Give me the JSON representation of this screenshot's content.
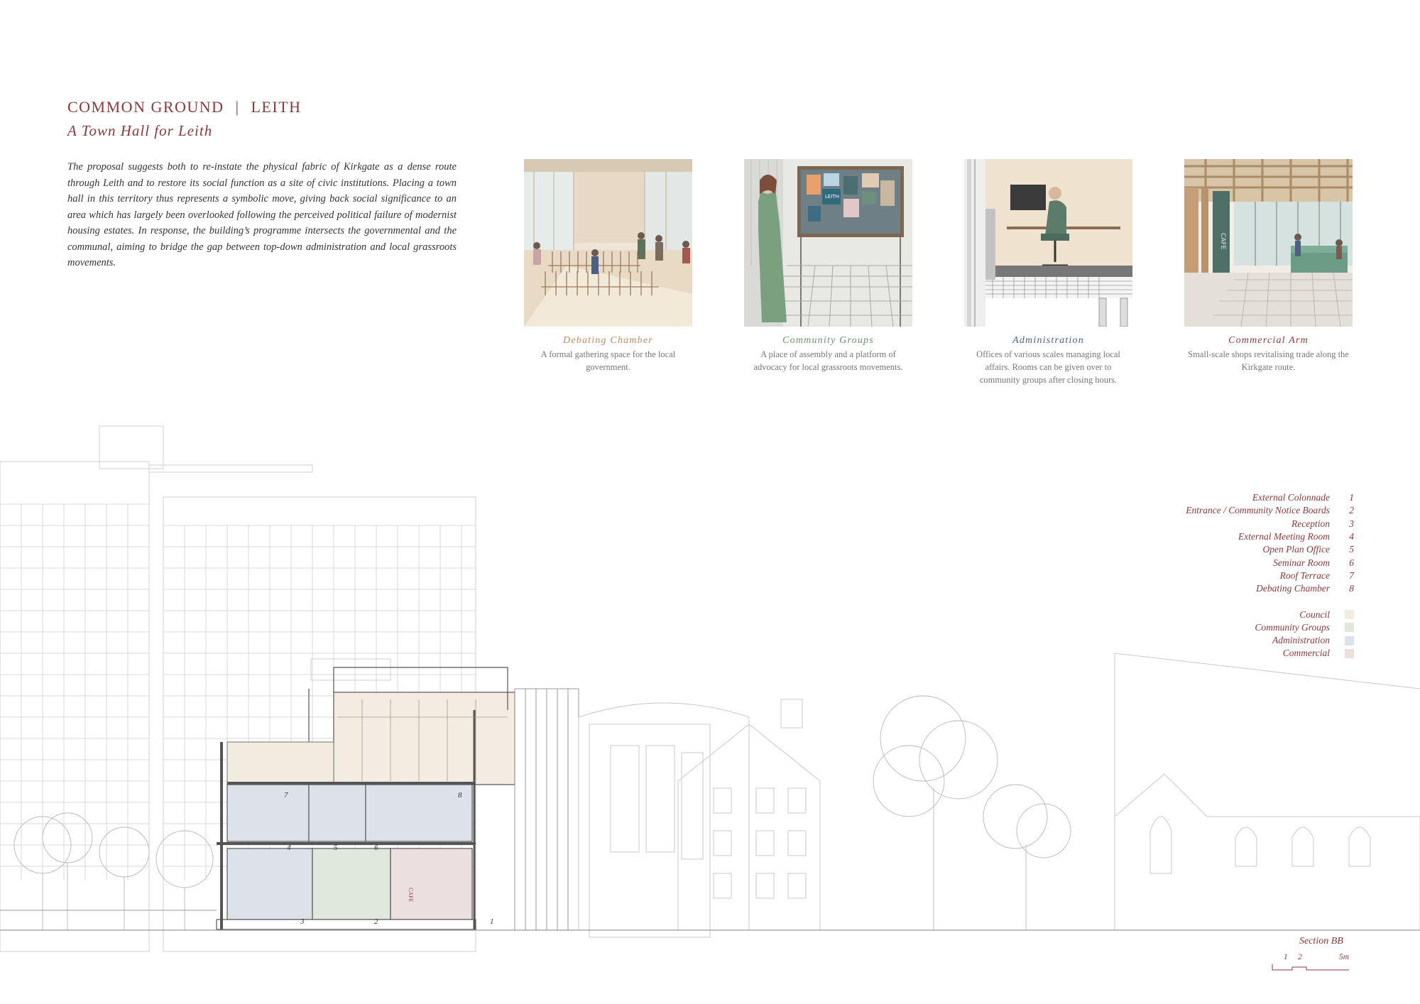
{
  "header": {
    "title_left": "COMMON GROUND",
    "title_sep": "|",
    "title_right": "LEITH",
    "subtitle": "A Town Hall for Leith"
  },
  "intro": "The proposal suggests both to re-instate the physical fabric of Kirkgate as a dense route through Leith and to restore its social function as a site of civic institutions. Placing a town hall in this territory thus represents a symbolic move, giving back social significance to an area which has largely been overlooked following the perceived political failure of modernist housing estates. In response, the building’s programme intersects the governmental and the communal, aiming to bridge the gap between top-down administration and local grassroots movements.",
  "vignettes": [
    {
      "title": "Debating Chamber",
      "desc": "A formal gathering space for the local government.",
      "color": "#c08a63"
    },
    {
      "title": "Community Groups",
      "desc": "A place of assembly and a platform of advocacy for local grassroots movements.",
      "color": "#6f8f72"
    },
    {
      "title": "Administration",
      "desc": "Offices of various scales managing local affairs. Rooms can be given over to community groups after closing hours.",
      "color": "#4e5f86"
    },
    {
      "title": "Commercial Arm",
      "desc": "Small-scale shops revitalising trade along the Kirkgate route.",
      "color": "#8a3a3c"
    }
  ],
  "vignette_images": {
    "debating": "",
    "notice_board": "LEITH",
    "cafe_sign": "CAFE"
  },
  "legend": {
    "rooms": [
      {
        "label": "External Colonnade",
        "num": "1"
      },
      {
        "label": "Entrance / Community Notice Boards",
        "num": "2"
      },
      {
        "label": "Reception",
        "num": "3"
      },
      {
        "label": "External Meeting Room",
        "num": "4"
      },
      {
        "label": "Open Plan Office",
        "num": "5"
      },
      {
        "label": "Seminar Room",
        "num": "6"
      },
      {
        "label": "Roof Terrace",
        "num": "7"
      },
      {
        "label": "Debating Chamber",
        "num": "8"
      }
    ],
    "zones": [
      {
        "label": "Council",
        "color": "#f1ebe0"
      },
      {
        "label": "Community Groups",
        "color": "#dfe8da"
      },
      {
        "label": "Administration",
        "color": "#dde2ea"
      },
      {
        "label": "Commercial",
        "color": "#ecdfe0"
      }
    ]
  },
  "section": {
    "label": "Section BB",
    "scale": {
      "t1": "1",
      "t2": "2",
      "t3": "5m"
    },
    "room_numbers": [
      "7",
      "8",
      "4",
      "5",
      "6",
      "3",
      "2",
      "1"
    ],
    "cafe_text": "CAFE"
  }
}
